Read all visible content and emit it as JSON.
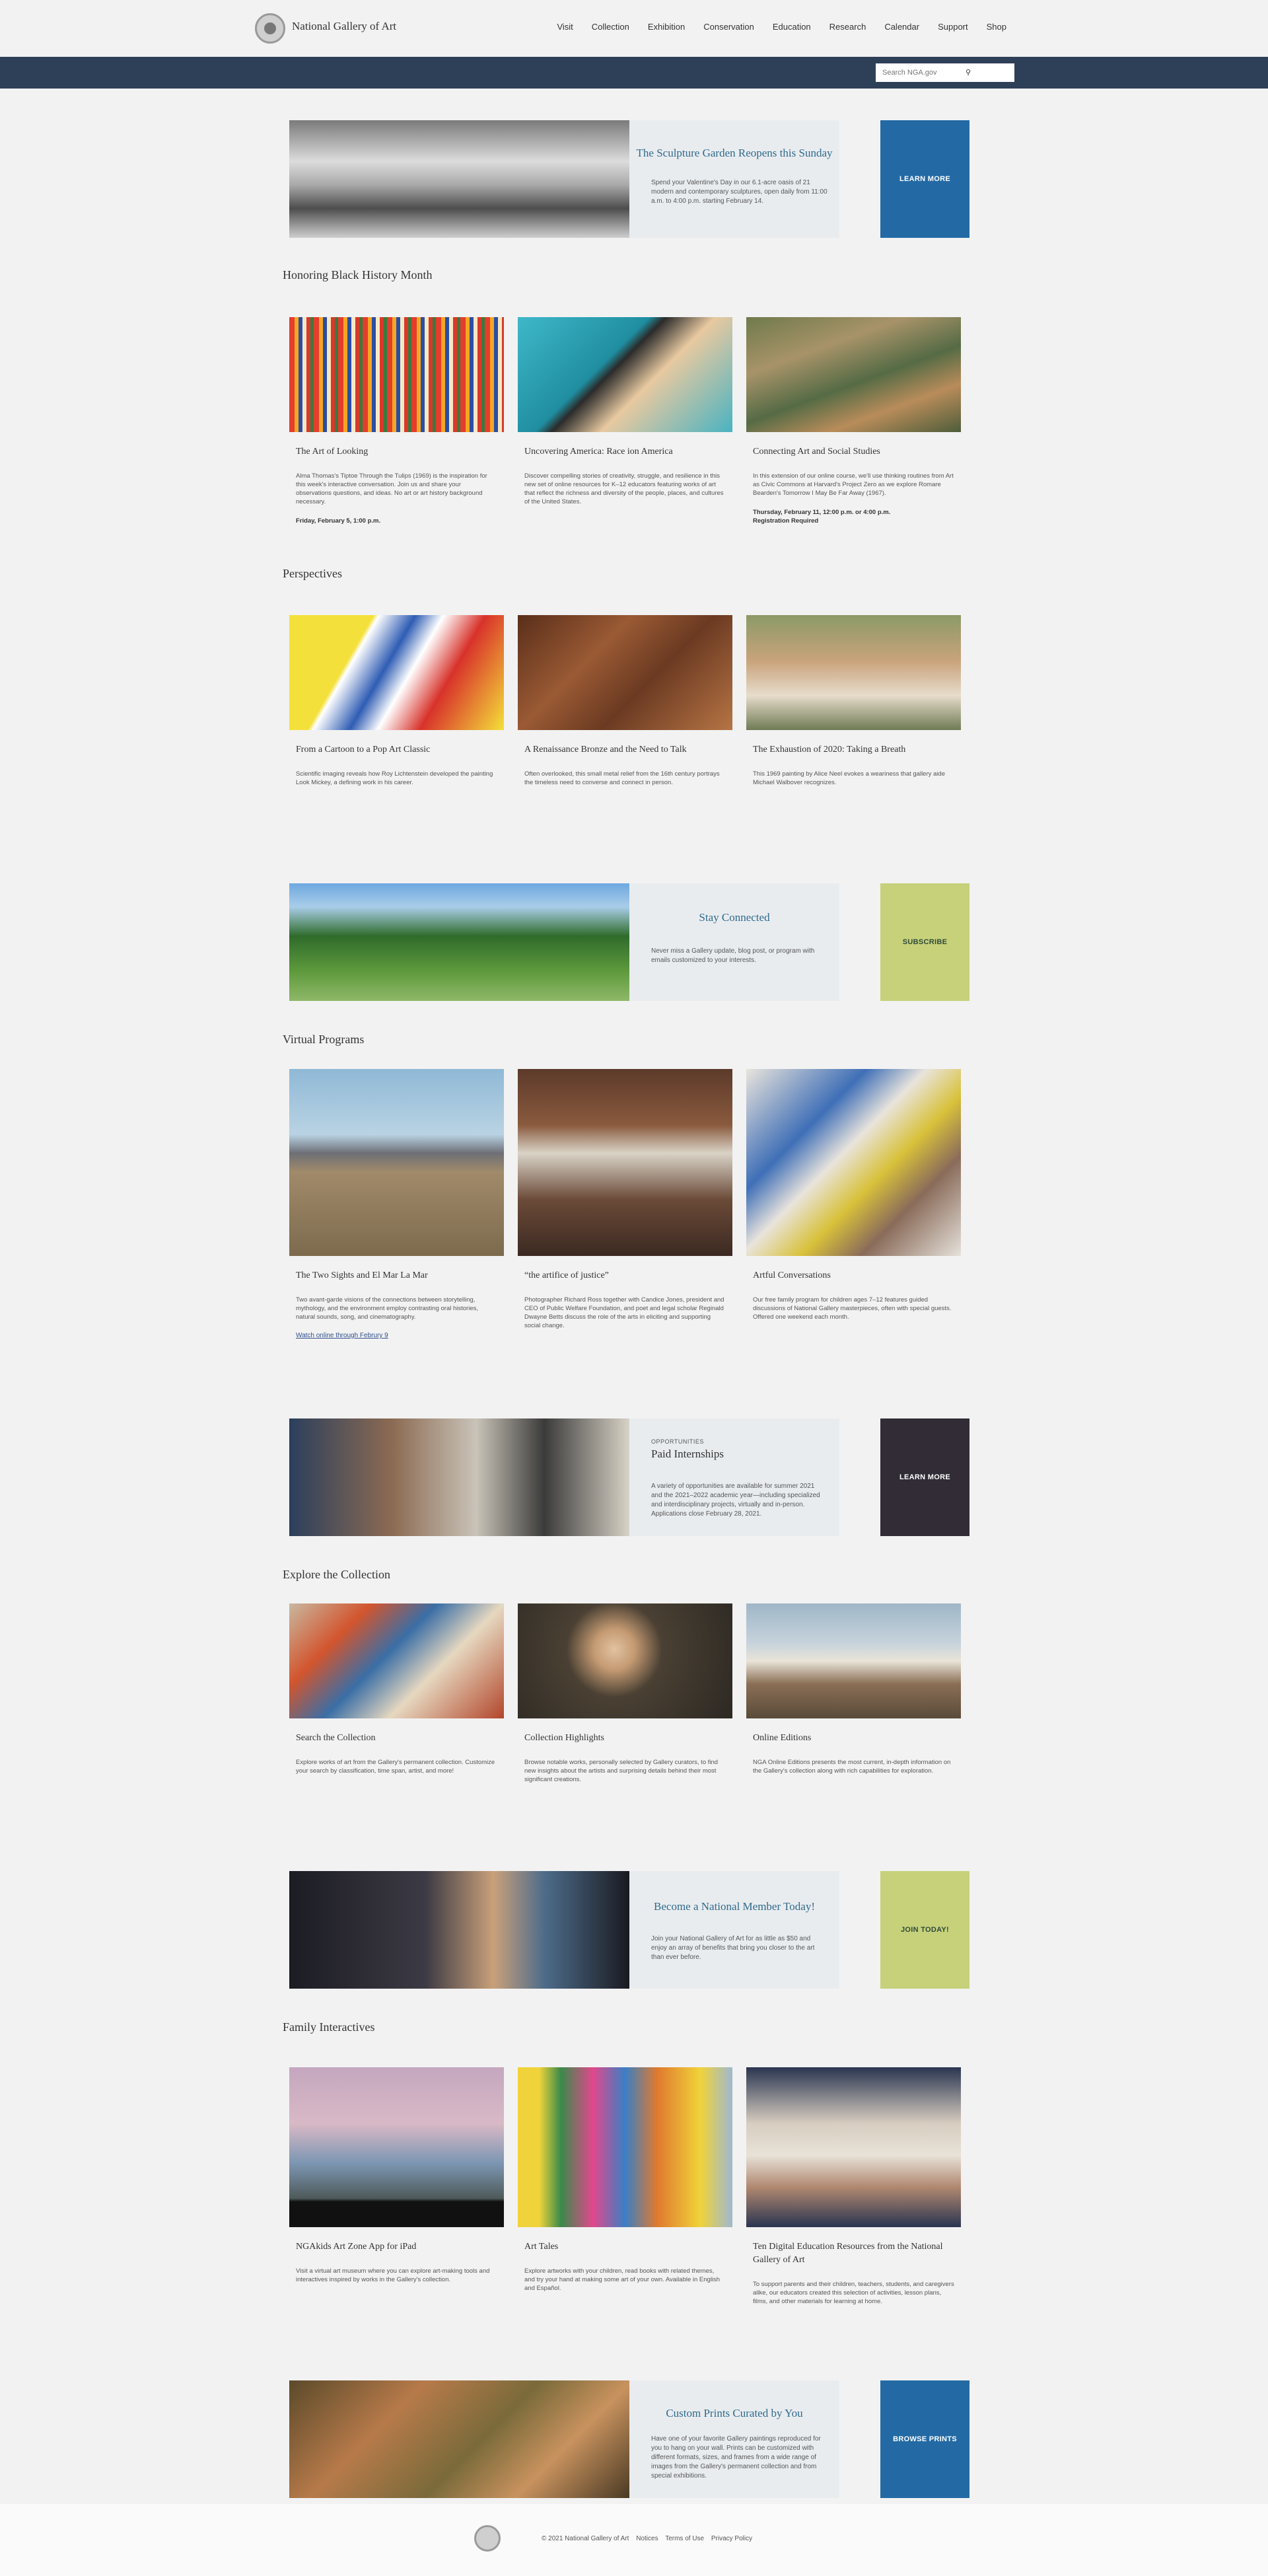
{
  "site": {
    "name": "National Gallery of Art"
  },
  "nav": [
    "Visit",
    "Collection",
    "Exhibition",
    "Conservation",
    "Education",
    "Research",
    "Calendar",
    "Support",
    "Shop"
  ],
  "search": {
    "placeholder": "Search NGA.gov"
  },
  "colors": {
    "header_bar": "#2e4057",
    "accent_blue": "#236aa5",
    "accent_green": "#c6d17a",
    "accent_dark": "#312c36",
    "headline_blue": "#2f6a8c"
  },
  "hero": {
    "title": "The Sculpture Garden Reopens this Sunday",
    "text": "Spend your Valentine's Day in our 6.1-acre oasis of 21 modern and contemporary sculptures, open daily from 11:00 a.m. to 4:00 p.m. starting February 14.",
    "cta": "LEARN MORE"
  },
  "black_history": {
    "title": "Honoring Black History Month",
    "cards": [
      {
        "title": "The Art of Looking",
        "text": "Alma Thomas's Tiptoe Through the Tulips (1969) is the inspiration for this week's interactive conversation. Join us and share your observations questions, and ideas. No art or art history background necessary.",
        "meta": "Friday, February 5, 1:00 p.m."
      },
      {
        "title": "Uncovering America: Race ion America",
        "text": "Discover compelling stories of creativity, struggle, and resilience in this new set of online resources for K–12 educators featuring works of art that reflect the richness and diversity of the people, places, and cultures of the United States."
      },
      {
        "title": "Connecting Art and Social Studies",
        "text": "In this extension of our online course, we'll use thinking routines from Art as Civic Commons at Harvard's Project Zero as we explore Romare Bearden's Tomorrow I May Be Far Away (1967).",
        "meta": "Thursday, February 11, 12:00 p.m. or 4:00 p.m.",
        "meta2": "Registration Required"
      }
    ]
  },
  "perspectives": {
    "title": "Perspectives",
    "cards": [
      {
        "title": "From a Cartoon to a Pop Art Classic",
        "text": "Scientific imaging reveals how Roy Lichtenstein developed the painting Look Mickey, a defining work in his career."
      },
      {
        "title": "A Renaissance Bronze and the Need to Talk",
        "text": "Often overlooked, this small metal relief from the 16th century portrays the timeless need to converse and connect in person."
      },
      {
        "title": "The Exhaustion of 2020: Taking a Breath",
        "text": "This 1969 painting by Alice Neel evokes a weariness that gallery aide Michael Walbover recognizes."
      }
    ]
  },
  "stay_connected": {
    "title": "Stay Connected",
    "text": "Never miss a Gallery update, blog post, or program with emails customized to your interests.",
    "cta": "SUBSCRIBE"
  },
  "virtual": {
    "title": "Virtual Programs",
    "cards": [
      {
        "title": "The Two Sights and El Mar La Mar",
        "text": "Two avant-garde visions of the connections between storytelling, mythology, and the environment employ contrasting oral histories, natural sounds, song, and cinematography.",
        "link": "Watch online through Februry 9"
      },
      {
        "title": "“the artifice of justice”",
        "text": "Photographer Richard Ross together with Candice Jones, president and CEO of Public Welfare Foundation, and poet and legal scholar Reginald Dwayne Betts discuss the role of the arts in eliciting and supporting social change."
      },
      {
        "title": "Artful Conversations",
        "text": "Our free family program for children ages 7–12 features guided discussions of National Gallery masterpieces, often with special guests. Offered one weekend each month."
      }
    ]
  },
  "internships": {
    "eyebrow": "OPPORTUNITIES",
    "title": "Paid Internships",
    "text": "A variety of opportunities are available for summer 2021 and the 2021–2022 academic year—including specialized and interdisciplinary projects, virtually and in-person. Applications close February 28, 2021.",
    "cta": "LEARN MORE"
  },
  "explore": {
    "title": "Explore the Collection",
    "cards": [
      {
        "title": "Search the Collection",
        "text": "Explore works of art from the Gallery's permanent collection. Customize your search by classification, time span, artist, and more!"
      },
      {
        "title": "Collection Highlights",
        "text": "Browse notable works, personally selected by Gallery curators, to find new insights about the artists and surprising details behind their most significant creations."
      },
      {
        "title": "Online Editions",
        "text": "NGA Online Editions presents the most current, in-depth information on the Gallery's collection along with rich capabilities for exploration."
      }
    ]
  },
  "member": {
    "title": "Become a National Member Today!",
    "text": "Join your National Gallery of Art for as little as $50 and enjoy an array of benefits that bring you closer to the art than ever before.",
    "cta": "JOIN TODAY!"
  },
  "family": {
    "title": "Family Interactives",
    "cards": [
      {
        "title": "NGAkids Art Zone App for iPad",
        "text": "Visit a virtual art museum where you can explore art-making tools and interactives inspired by works in the Gallery's collection."
      },
      {
        "title": "Art Tales",
        "text": "Explore artworks with your children, read books with related themes, and try your hand at making some art of your own. Available in English and Español."
      },
      {
        "title": "Ten Digital Education Resources from the National Gallery of Art",
        "text": "To support parents and their children, teachers, students, and caregivers alike, our educators created this selection of activities, lesson plans, films, and other materials for learning at home."
      }
    ]
  },
  "prints": {
    "title": "Custom Prints Curated by You",
    "text": "Have one of your favorite Gallery paintings reproduced for you to hang on your wall. Prints can be customized with different formats, sizes, and frames from a wide range of images from the Gallery's permanent collection and from special exhibitions.",
    "cta": "BROWSE PRINTS"
  },
  "footer": {
    "copyright": "© 2021 National Gallery of Art",
    "links": [
      "Notices",
      "Terms of Use",
      "Privacy Policy"
    ]
  }
}
